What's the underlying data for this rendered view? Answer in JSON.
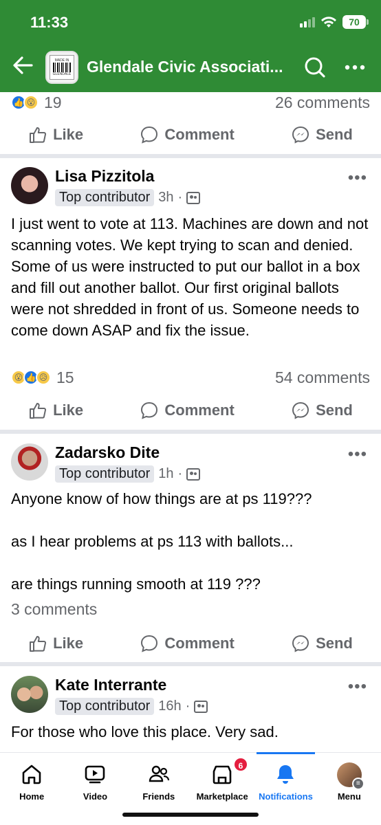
{
  "status_bar": {
    "time": "11:33",
    "battery": "70"
  },
  "header": {
    "title": "Glendale Civic Associati...",
    "logo_text_top": "MADE IN",
    "logo_text_bottom": "GLENDALE"
  },
  "colors": {
    "header_bg": "#2f8b35",
    "accent": "#1877f2",
    "muted": "#65676b"
  },
  "top_summary": {
    "reaction_count": "19",
    "comments": "26 comments"
  },
  "actions": {
    "like": "Like",
    "comment": "Comment",
    "send": "Send"
  },
  "posts": [
    {
      "author": "Lisa Pizzitola",
      "badge": "Top contributor",
      "time": "3h",
      "text": "I just went to vote at 113.  Machines are down and not scanning votes.  We kept trying to scan and denied.  Some of us were instructed to put our ballot in a box and fill out another ballot.  Our first original ballots were not shredded in front of us.  Someone needs to come down ASAP and fix the issue.",
      "reaction_count": "15",
      "comments": "54 comments"
    },
    {
      "author": "Zadarsko Dite",
      "badge": "Top contributor",
      "time": "1h",
      "text_lines": [
        "Anyone know of how things are at ps 119???",
        "as I hear problems at ps 113 with ballots...",
        "are things running smooth at 119 ???"
      ],
      "comments": "3 comments"
    },
    {
      "author": "Kate Interrante",
      "badge": "Top contributor",
      "time": "16h",
      "text": "For those who love this place. Very sad."
    }
  ],
  "nav": {
    "home": "Home",
    "video": "Video",
    "friends": "Friends",
    "marketplace": "Marketplace",
    "marketplace_badge": "6",
    "notifications": "Notifications",
    "menu": "Menu"
  }
}
